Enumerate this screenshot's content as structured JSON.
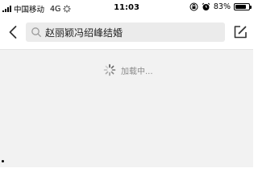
{
  "status_bar": {
    "carrier": "中国移动",
    "network": "4G",
    "time": "11:03",
    "battery_percent": "83%",
    "battery_level": 0.83
  },
  "nav": {
    "back_icon": "chevron-left-icon",
    "search_icon": "search-icon",
    "search_query": "赵丽颖冯绍峰结婚",
    "compose_icon": "edit-icon"
  },
  "content": {
    "loading_text": "加载中..."
  },
  "colors": {
    "nav_bg": "#ffffff",
    "search_bg": "#ebebeb",
    "content_bg": "#f2f2f2",
    "loading_text": "#8a8a8a"
  }
}
